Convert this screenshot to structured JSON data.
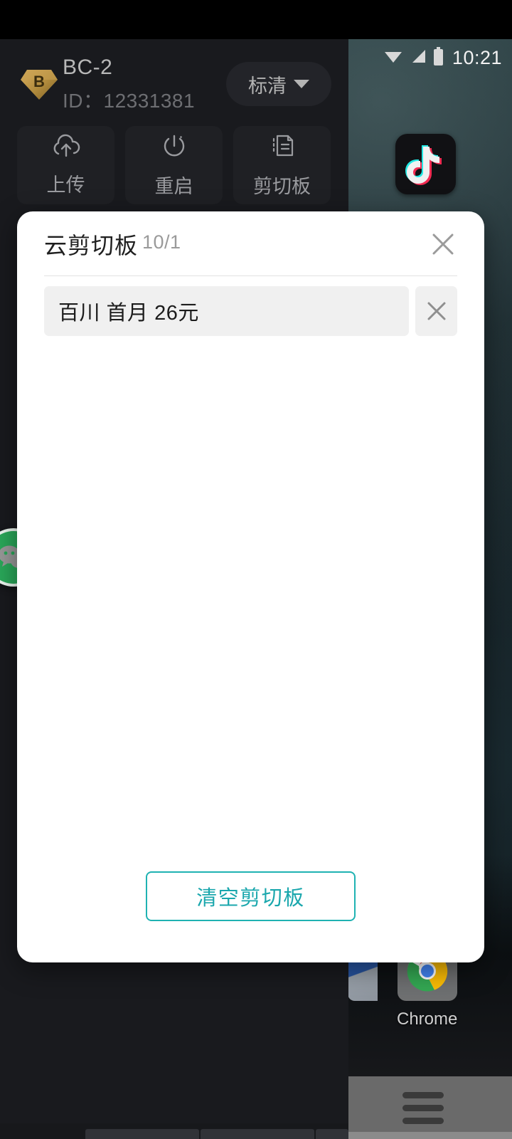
{
  "statusbar": {
    "time": "10:21",
    "icons": [
      "wifi-icon",
      "cellular-signal-icon",
      "battery-icon"
    ]
  },
  "homescreen": {
    "apps": [
      {
        "name": "tiktok-app-icon",
        "label": ""
      },
      {
        "name": "chrome-app-icon",
        "label": "Chrome"
      }
    ],
    "chrome_label": "Chrome",
    "menu_icon": "hamburger-menu-icon"
  },
  "device_panel": {
    "logo_letter": "B",
    "name": "BC-2",
    "id_label": "ID：12331381",
    "quality": {
      "selected": "标清",
      "caret_icon": "chevron-down-icon"
    },
    "actions": [
      {
        "icon": "cloud-upload-icon",
        "label": "上传"
      },
      {
        "icon": "power-restart-icon",
        "label": "重启"
      },
      {
        "icon": "clipboard-copy-icon",
        "label": "剪切板"
      }
    ],
    "floating_icon": "wechat-floating-icon"
  },
  "dialog": {
    "title": "云剪切板",
    "count": "10/1",
    "close_icon": "close-icon",
    "items": [
      {
        "text": "百川 首月 26元",
        "delete_icon": "delete-icon"
      }
    ],
    "clear_button": "清空剪切板"
  },
  "colors": {
    "accent_teal": "#1aa7ad",
    "dialog_bg": "#ffffff",
    "app_bg": "#191a1e",
    "item_bg": "#f0f0f0",
    "logo_gold": "#b98f3e"
  }
}
